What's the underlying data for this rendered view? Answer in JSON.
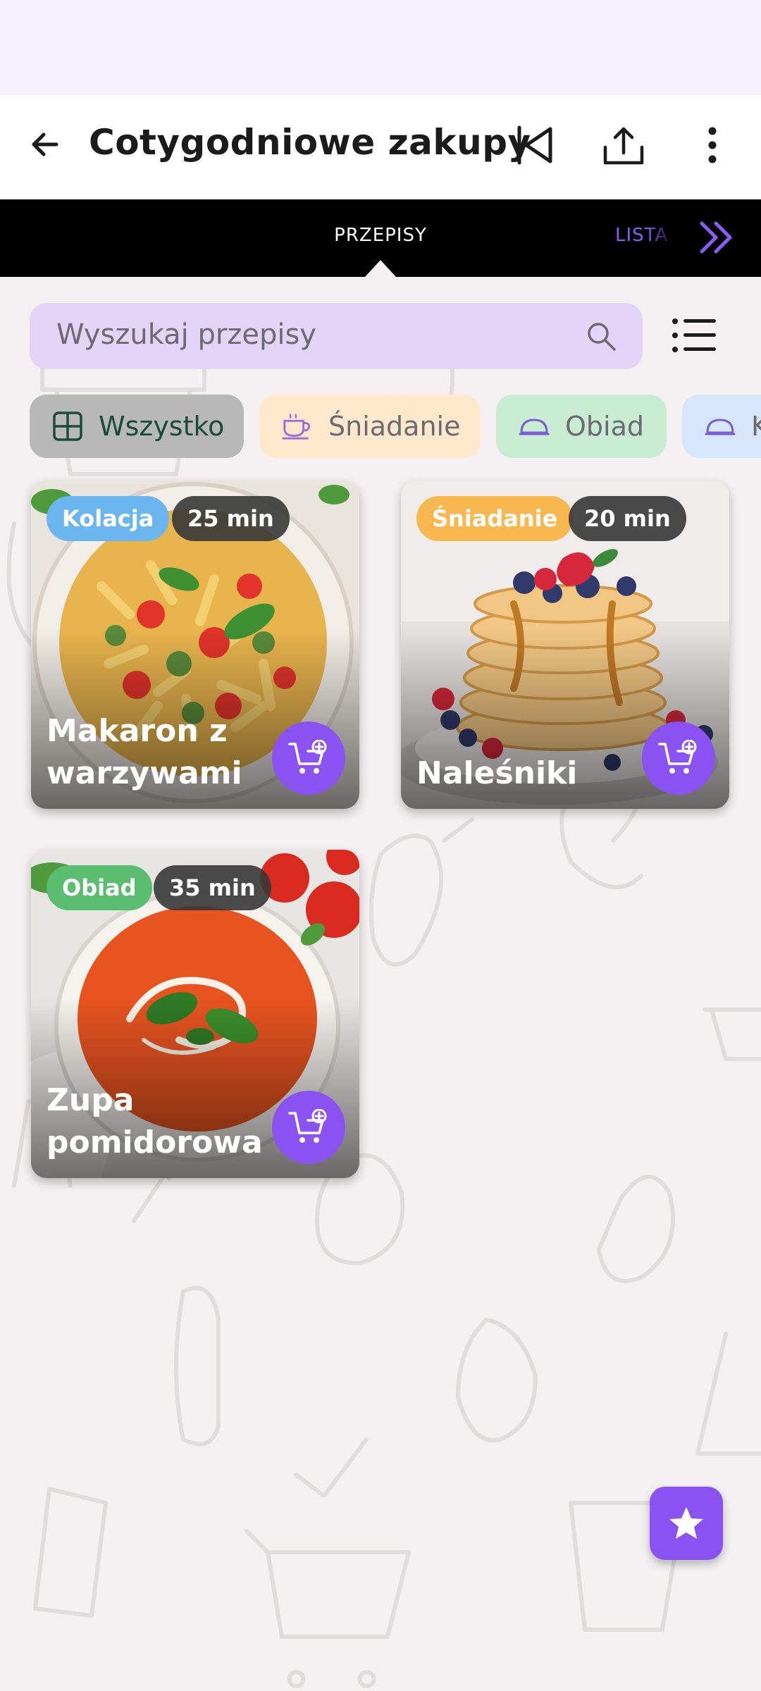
{
  "app_bar": {
    "title": "Cotygodniowe zakupy",
    "back_icon": "arrow-left-icon",
    "actions": [
      "skip-previous-icon",
      "share-icon",
      "more-vert-icon"
    ]
  },
  "tabs": {
    "active": "PRZEPISY",
    "next": "LISTA",
    "next_icon": "double-chevron-right-icon"
  },
  "search": {
    "placeholder": "Wyszukaj przepisy",
    "icon": "search-icon"
  },
  "filters": [
    {
      "label": "Wszystko",
      "icon": "grid-icon",
      "color": "#b8b8b8",
      "text_color": "#1a4a3a"
    },
    {
      "label": "Śniadanie",
      "icon": "coffee-cup-icon",
      "color": "#ffe8cc",
      "text_color": "#6d6a73"
    },
    {
      "label": "Obiad",
      "icon": "cloche-icon",
      "color": "#c9edd3",
      "text_color": "#6d6a73"
    },
    {
      "label": "K",
      "icon": "cloche-icon",
      "color": "#d7e7fb",
      "text_color": "#6d6a73"
    }
  ],
  "recipes": [
    {
      "name": "Makaron z warzywami",
      "category": "Kolacja",
      "category_color": "#6cb6f0",
      "time": "25 min"
    },
    {
      "name": "Naleśniki",
      "category": "Śniadanie",
      "category_color": "#f8b74f",
      "time": "20 min"
    },
    {
      "name": "Zupa pomidorowa",
      "category": "Obiad",
      "category_color": "#5bbd6f",
      "time": "35 min"
    }
  ],
  "fab_icon": "star-icon",
  "colors": {
    "accent": "#8b52f2",
    "search_bg": "#e3d5f7"
  }
}
